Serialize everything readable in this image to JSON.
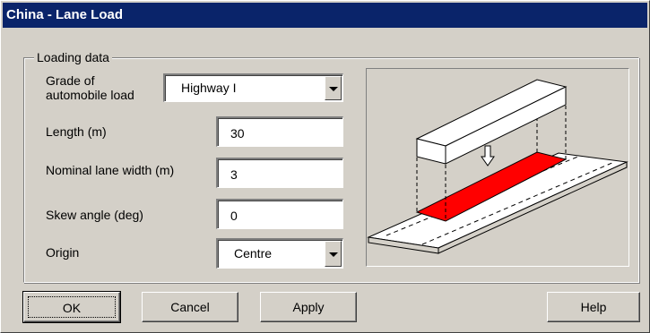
{
  "window": {
    "title": "China - Lane Load"
  },
  "loading_group": {
    "legend": "Loading data",
    "grade_label_line1": "Grade of",
    "grade_label_line2": "automobile load",
    "grade_value": "Highway I",
    "length_label": "Length (m)",
    "length_value": "30",
    "width_label": "Nominal lane width (m)",
    "width_value": "3",
    "skew_label": "Skew angle (deg)",
    "skew_value": "0",
    "origin_label": "Origin",
    "origin_value": "Centre"
  },
  "illustration": {
    "load_color": "#ff0000",
    "icon": "lane-load-diagram"
  },
  "buttons": {
    "ok": "OK",
    "cancel": "Cancel",
    "apply": "Apply",
    "help": "Help"
  }
}
